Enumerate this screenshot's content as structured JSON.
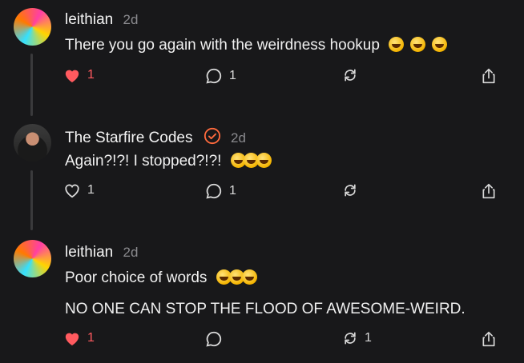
{
  "colors": {
    "background": "#18181a",
    "accent_red": "#ff5a5f",
    "verified": "#ff6a3d",
    "muted": "#8a8a8e"
  },
  "posts": [
    {
      "author": "leithian",
      "time": "2d",
      "lines": [
        "There you go again with the weirdness hookup"
      ],
      "emoji_count": 3,
      "likes": "1",
      "liked": true,
      "replies": "1",
      "reposts": ""
    },
    {
      "author": "The Starfire Codes",
      "verified": true,
      "time": "2d",
      "lines": [
        "Again?!?! I stopped?!?!"
      ],
      "emoji_count": 3,
      "likes": "1",
      "liked": false,
      "replies": "1",
      "reposts": ""
    },
    {
      "author": "leithian",
      "time": "2d",
      "lines": [
        "Poor choice of words",
        "NO ONE CAN STOP THE FLOOD OF AWESOME-WEIRD."
      ],
      "emoji_count": 3,
      "likes": "1",
      "liked": true,
      "replies": "",
      "reposts": "1"
    }
  ]
}
